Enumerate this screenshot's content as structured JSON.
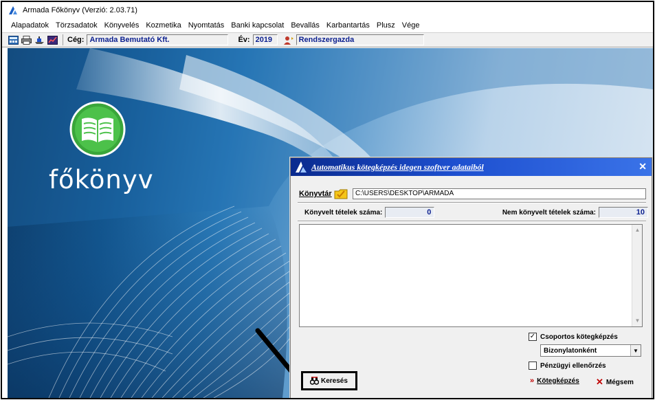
{
  "window": {
    "title": "Armada Főkönyv (Verzió: 2.03.71)"
  },
  "menu": [
    "Alapadatok",
    "Törzsadatok",
    "Könyvelés",
    "Kozmetika",
    "Nyomtatás",
    "Banki kapcsolat",
    "Bevallás",
    "Karbantartás",
    "Plusz",
    "Vége"
  ],
  "toolbar": {
    "ceg_label": "Cég:",
    "ceg_value": "Armada Bemutató Kft.",
    "ev_label": "Év:",
    "ev_value": "2019",
    "user_value": "Rendszergazda"
  },
  "brand": {
    "text": "főkönyv"
  },
  "dialog": {
    "title": "Automatikus kötegképzés idegen szoftver adataiból",
    "close": "✕",
    "konyvtar_label": "Könyvtár",
    "konyvtar_path": "C:\\USERS\\DESKTOP\\ARMADA",
    "konyvelt_label": "Könyvelt tételek száma:",
    "konyvelt_value": "0",
    "nem_konyvelt_label": "Nem könyvelt tételek száma:",
    "nem_konyvelt_value": "10",
    "csoportos_label": "Csoportos kötegképzés",
    "csoportos_checked": true,
    "bizonylat_option": "Bizonylatonként",
    "penzugyi_label": "Pénzügyi ellenőrzés",
    "penzugyi_checked": false,
    "kereses_label": "Keresés",
    "kotegkepzes_label": "Kötegképzés",
    "megsem_label": "Mégsem"
  },
  "colors": {
    "title_gradient_start": "#0a2a8e",
    "title_gradient_end": "#3a73e8",
    "value_text": "#0b1f8f",
    "cancel_icon": "#c00000"
  }
}
